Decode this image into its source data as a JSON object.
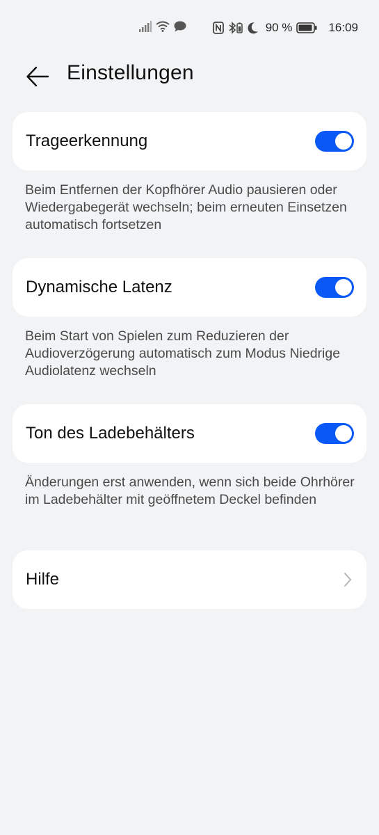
{
  "status_bar": {
    "battery_percent": "90 %",
    "time": "16:09",
    "left_icons": [
      "signal-icon",
      "wifi-icon",
      "message-icon"
    ],
    "right_icons": [
      "nfc-icon",
      "bluetooth-battery-icon",
      "moon-icon",
      "battery-icon"
    ]
  },
  "header": {
    "title": "Einstellungen",
    "back_icon": "back-arrow-icon"
  },
  "settings": [
    {
      "label": "Trageerkennung",
      "enabled": true,
      "description": "Beim Entfernen der Kopfhörer Audio pausieren oder Wiedergabegerät wechseln; beim erneuten Einsetzen automatisch fortsetzen"
    },
    {
      "label": "Dynamische Latenz",
      "enabled": true,
      "description": "Beim Start von Spielen zum Reduzieren der Audioverzögerung automatisch zum Modus Niedrige Audiolatenz wechseln"
    },
    {
      "label": "Ton des Ladebehälters",
      "enabled": true,
      "description": "Änderungen erst anwenden, wenn sich beide Ohrhörer im Ladebehälter mit geöffnetem Deckel befinden"
    }
  ],
  "help": {
    "label": "Hilfe",
    "icon": "chevron-right-icon"
  },
  "colors": {
    "background": "#f1f3f5",
    "card": "#ffffff",
    "accent": "#0a59f7"
  }
}
